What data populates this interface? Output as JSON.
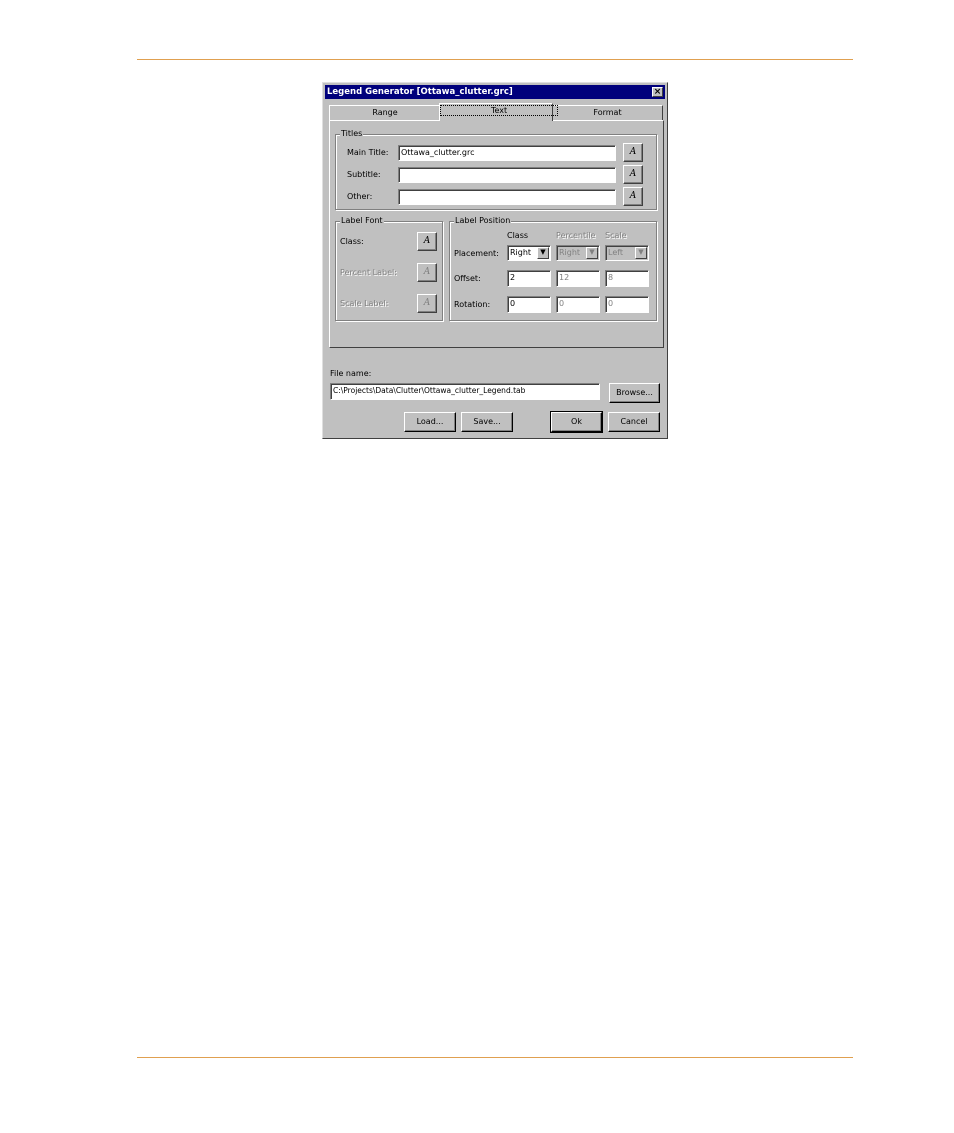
{
  "colors": {
    "rule": "#e0a050",
    "titlebar": "#00007c",
    "face": "#c0c0c0"
  },
  "dialog": {
    "title": "Legend Generator [Ottawa_clutter.grc]",
    "close_icon": "close-icon",
    "tabs": [
      {
        "label": "Range"
      },
      {
        "label": "Text",
        "active": true
      },
      {
        "label": "Format"
      }
    ],
    "titles_group": {
      "label": "Titles",
      "main_title_label": "Main Title:",
      "main_title_value": "Ottawa_clutter.grc",
      "subtitle_label": "Subtitle:",
      "subtitle_value": "",
      "other_label": "Other:",
      "other_value": "",
      "font_icon": "font-icon"
    },
    "label_font_group": {
      "label": "Label Font",
      "class_label": "Class:",
      "percent_label": "Percent Label:",
      "scale_label": "Scale Label:"
    },
    "label_position_group": {
      "label": "Label Position",
      "col_class": "Class",
      "col_percentile": "Percentile",
      "col_scale": "Scale",
      "placement_label": "Placement:",
      "placement_values": [
        "Right",
        "Right",
        "Left"
      ],
      "offset_label": "Offset:",
      "offset_values": [
        "2",
        "12",
        "8"
      ],
      "rotation_label": "Rotation:",
      "rotation_values": [
        "0",
        "0",
        "0"
      ]
    },
    "file": {
      "label": "File name:",
      "value": "C:\\Projects\\Data\\Clutter\\Ottawa_clutter_Legend.tab",
      "browse": "Browse..."
    },
    "buttons": {
      "load": "Load...",
      "save": "Save...",
      "ok": "Ok",
      "cancel": "Cancel"
    }
  }
}
